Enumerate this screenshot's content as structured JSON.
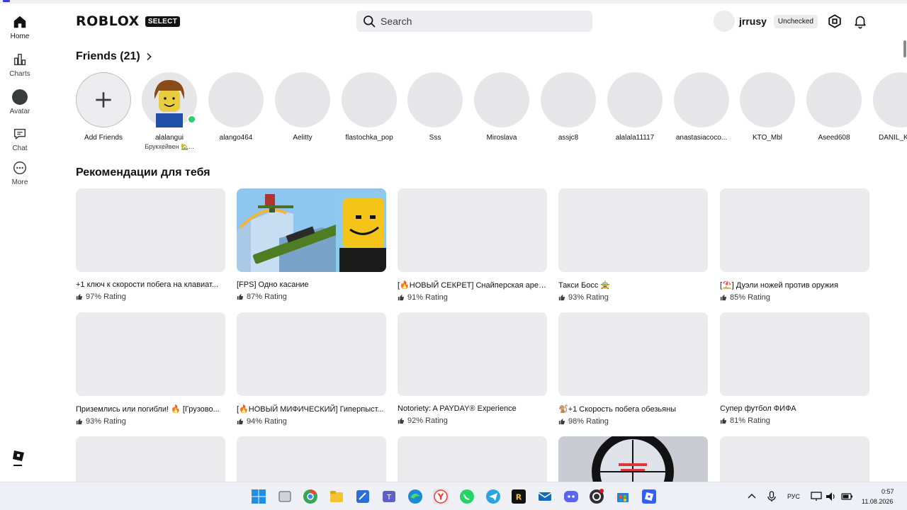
{
  "sidebar": {
    "items": [
      {
        "label": "Home"
      },
      {
        "label": "Charts"
      },
      {
        "label": "Avatar"
      },
      {
        "label": "Chat"
      },
      {
        "label": "More"
      }
    ]
  },
  "header": {
    "logo_text": "RΟBLOX",
    "logo_badge": "SELECT",
    "search_placeholder": "Search",
    "username": "jrrusy",
    "status_badge": "Unchecked"
  },
  "friends": {
    "title": "Friends (21)",
    "add_label": "Add Friends",
    "list": [
      {
        "name": "alalangui",
        "status": "Брукхейвен 🏡..."
      },
      {
        "name": "alango464"
      },
      {
        "name": "Aelitty"
      },
      {
        "name": "flastochka_pop"
      },
      {
        "name": "Sss"
      },
      {
        "name": "Miroslava"
      },
      {
        "name": "assjc8"
      },
      {
        "name": "alalala11117"
      },
      {
        "name": "anastasiacoco..."
      },
      {
        "name": "KTO_Mbl"
      },
      {
        "name": "Aseed608"
      },
      {
        "name": "DANIL_K"
      }
    ]
  },
  "recommendations": {
    "title": "Рекомендации для тебя",
    "games": [
      {
        "title": "+1 ключ к скорости побега на клавиат...",
        "rating": "97% Rating"
      },
      {
        "title": "[FPS] Одно касание",
        "rating": "87% Rating"
      },
      {
        "title": "[🔥НОВЫЙ СЕКРЕТ] Снайперская арена",
        "rating": "91% Rating"
      },
      {
        "title": "Такси Босс 🚖",
        "rating": "93% Rating"
      },
      {
        "title": "[⛱️] Дуэли ножей против оружия",
        "rating": "85% Rating"
      },
      {
        "title": "Приземлись или погибли! 🔥 [Грузово...",
        "rating": "93% Rating"
      },
      {
        "title": "[🔥НОВЫЙ МИФИЧЕСКИЙ] Гиперпыст...",
        "rating": "94% Rating"
      },
      {
        "title": "Notoriety: A PAYDAY® Experience",
        "rating": "92% Rating"
      },
      {
        "title": "🐒+1 Скорость побега обезьяны",
        "rating": "98% Rating"
      },
      {
        "title": "Супер футбол ФИФА",
        "rating": "81% Rating"
      }
    ]
  },
  "taskbar": {
    "lang": "РУС",
    "time": "0:57",
    "date": "11.08.2026"
  },
  "colors": {
    "online": "#2ecc71",
    "placeholder": "#ebebed",
    "taskbar": "#eef0f5"
  }
}
